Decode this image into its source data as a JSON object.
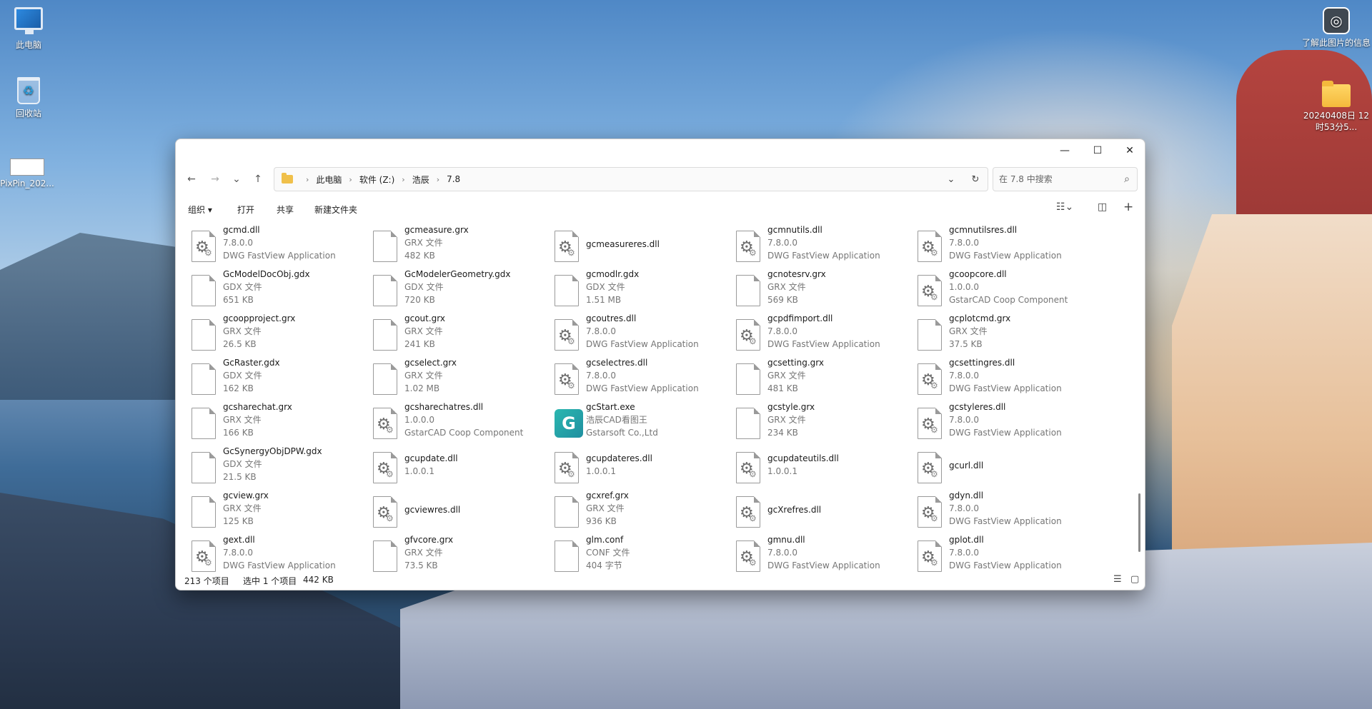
{
  "desktop": {
    "icons": [
      {
        "label": "此电脑"
      },
      {
        "label": "回收站"
      },
      {
        "label": "PixPin_202..."
      },
      {
        "label": "了解此图片的信息"
      },
      {
        "label": "20240408日 12时53分5..."
      }
    ]
  },
  "window": {
    "controls": {
      "minimize": "—",
      "maximize": "☐",
      "close": "✕"
    },
    "nav": {
      "back": "←",
      "forward": "→",
      "recent": "⌄",
      "up": "↑"
    },
    "breadcrumb": [
      "此电脑",
      "软件 (Z:)",
      "浩辰",
      "7.8"
    ],
    "search": {
      "placeholder": "在 7.8 中搜索"
    },
    "toolbar": {
      "organize": "组织 ▾",
      "open": "打开",
      "share": "共享",
      "new_folder": "新建文件夹"
    },
    "files": [
      {
        "name": "gcmd.dll",
        "line2": "7.8.0.0",
        "line3": "DWG FastView Application",
        "icon": "dll"
      },
      {
        "name": "gcmeasure.grx",
        "line2": "GRX 文件",
        "line3": "482 KB",
        "icon": "file"
      },
      {
        "name": "gcmeasureres.dll",
        "line2": "",
        "line3": "",
        "icon": "dll"
      },
      {
        "name": "gcmnutils.dll",
        "line2": "7.8.0.0",
        "line3": "DWG FastView Application",
        "icon": "dll"
      },
      {
        "name": "gcmnutilsres.dll",
        "line2": "7.8.0.0",
        "line3": "DWG FastView Application",
        "icon": "dll"
      },
      {
        "name": "GcModelDocObj.gdx",
        "line2": "GDX 文件",
        "line3": "651 KB",
        "icon": "file"
      },
      {
        "name": "GcModelerGeometry.gdx",
        "line2": "GDX 文件",
        "line3": "720 KB",
        "icon": "file"
      },
      {
        "name": "gcmodlr.gdx",
        "line2": "GDX 文件",
        "line3": "1.51 MB",
        "icon": "file"
      },
      {
        "name": "gcnotesrv.grx",
        "line2": "GRX 文件",
        "line3": "569 KB",
        "icon": "file"
      },
      {
        "name": "gcoopcore.dll",
        "line2": "1.0.0.0",
        "line3": "GstarCAD Coop Component",
        "icon": "dll"
      },
      {
        "name": "gcoopproject.grx",
        "line2": "GRX 文件",
        "line3": "26.5 KB",
        "icon": "file"
      },
      {
        "name": "gcout.grx",
        "line2": "GRX 文件",
        "line3": "241 KB",
        "icon": "file"
      },
      {
        "name": "gcoutres.dll",
        "line2": "7.8.0.0",
        "line3": "DWG FastView Application",
        "icon": "dll"
      },
      {
        "name": "gcpdfimport.dll",
        "line2": "7.8.0.0",
        "line3": "DWG FastView Application",
        "icon": "dll"
      },
      {
        "name": "gcplotcmd.grx",
        "line2": "GRX 文件",
        "line3": "37.5 KB",
        "icon": "file"
      },
      {
        "name": "GcRaster.gdx",
        "line2": "GDX 文件",
        "line3": "162 KB",
        "icon": "file"
      },
      {
        "name": "gcselect.grx",
        "line2": "GRX 文件",
        "line3": "1.02 MB",
        "icon": "file"
      },
      {
        "name": "gcselectres.dll",
        "line2": "7.8.0.0",
        "line3": "DWG FastView Application",
        "icon": "dll"
      },
      {
        "name": "gcsetting.grx",
        "line2": "GRX 文件",
        "line3": "481 KB",
        "icon": "file"
      },
      {
        "name": "gcsettingres.dll",
        "line2": "7.8.0.0",
        "line3": "DWG FastView Application",
        "icon": "dll"
      },
      {
        "name": "gcsharechat.grx",
        "line2": "GRX 文件",
        "line3": "166 KB",
        "icon": "file"
      },
      {
        "name": "gcsharechatres.dll",
        "line2": "1.0.0.0",
        "line3": "GstarCAD Coop Component",
        "icon": "dll"
      },
      {
        "name": "gcStart.exe",
        "line2": "浩辰CAD看图王",
        "line3": "Gstarsoft Co.,Ltd",
        "icon": "exe"
      },
      {
        "name": "gcstyle.grx",
        "line2": "GRX 文件",
        "line3": "234 KB",
        "icon": "file"
      },
      {
        "name": "gcstyleres.dll",
        "line2": "7.8.0.0",
        "line3": "DWG FastView Application",
        "icon": "dll"
      },
      {
        "name": "GcSynergyObjDPW.gdx",
        "line2": "GDX 文件",
        "line3": "21.5 KB",
        "icon": "file"
      },
      {
        "name": "gcupdate.dll",
        "line2": "1.0.0.1",
        "line3": "",
        "icon": "dll"
      },
      {
        "name": "gcupdateres.dll",
        "line2": "1.0.0.1",
        "line3": "",
        "icon": "dll"
      },
      {
        "name": "gcupdateutils.dll",
        "line2": "1.0.0.1",
        "line3": "",
        "icon": "dll"
      },
      {
        "name": "gcurl.dll",
        "line2": "",
        "line3": "",
        "icon": "dll"
      },
      {
        "name": "gcview.grx",
        "line2": "GRX 文件",
        "line3": "125 KB",
        "icon": "file"
      },
      {
        "name": "gcviewres.dll",
        "line2": "",
        "line3": "",
        "icon": "dll"
      },
      {
        "name": "gcxref.grx",
        "line2": "GRX 文件",
        "line3": "936 KB",
        "icon": "file"
      },
      {
        "name": "gcXrefres.dll",
        "line2": "",
        "line3": "",
        "icon": "dll"
      },
      {
        "name": "gdyn.dll",
        "line2": "7.8.0.0",
        "line3": "DWG FastView Application",
        "icon": "dll"
      },
      {
        "name": "gext.dll",
        "line2": "7.8.0.0",
        "line3": "DWG FastView Application",
        "icon": "dll"
      },
      {
        "name": "gfvcore.grx",
        "line2": "GRX 文件",
        "line3": "73.5 KB",
        "icon": "file"
      },
      {
        "name": "glm.conf",
        "line2": "CONF 文件",
        "line3": "404 字节",
        "icon": "file"
      },
      {
        "name": "gmnu.dll",
        "line2": "7.8.0.0",
        "line3": "DWG FastView Application",
        "icon": "dll"
      },
      {
        "name": "gplot.dll",
        "line2": "7.8.0.0",
        "line3": "DWG FastView Application",
        "icon": "dll"
      }
    ],
    "status": {
      "item_count": "213 个项目",
      "selected": "选中 1 个项目",
      "selected_size": "442 KB"
    }
  }
}
